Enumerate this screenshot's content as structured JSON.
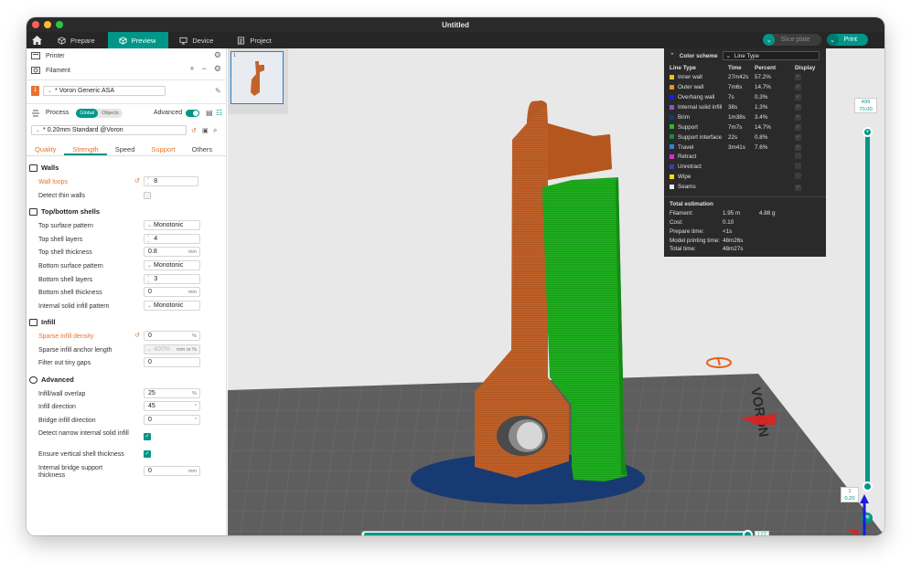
{
  "window": {
    "title": "Untitled"
  },
  "tabs": [
    {
      "label": "Prepare",
      "icon": "cube-outline-icon"
    },
    {
      "label": "Preview",
      "icon": "preview-cube-icon"
    },
    {
      "label": "Device",
      "icon": "device-icon"
    },
    {
      "label": "Project",
      "icon": "project-icon"
    }
  ],
  "toolbar": {
    "slice_label": "Slice plate",
    "print_label": "Print"
  },
  "sidebar": {
    "printer_label": "Printer",
    "filament_label": "Filament",
    "filament_slot": "1",
    "filament_value": "* Voron Generic ASA",
    "process_label": "Process",
    "process_toggle": [
      "Global",
      "Objects"
    ],
    "advanced_label": "Advanced",
    "process_value": "* 0.20mm Standard @Voron",
    "subtabs": [
      "Quality",
      "Strength",
      "Speed",
      "Support",
      "Others"
    ],
    "groups": {
      "walls": "Walls",
      "topbottom": "Top/bottom shells",
      "infill": "Infill",
      "advanced": "Advanced"
    },
    "settings": {
      "wall_loops": {
        "label": "Wall loops",
        "value": "8"
      },
      "detect_thin_walls": {
        "label": "Detect thin walls"
      },
      "top_surface_pattern": {
        "label": "Top surface pattern",
        "value": "Monotonic"
      },
      "top_shell_layers": {
        "label": "Top shell layers",
        "value": "4"
      },
      "top_shell_thickness": {
        "label": "Top shell thickness",
        "value": "0.8",
        "unit": "mm"
      },
      "bottom_surface_pattern": {
        "label": "Bottom surface pattern",
        "value": "Monotonic"
      },
      "bottom_shell_layers": {
        "label": "Bottom shell layers",
        "value": "3"
      },
      "bottom_shell_thickness": {
        "label": "Bottom shell thickness",
        "value": "0",
        "unit": "mm"
      },
      "internal_solid_infill_pattern": {
        "label": "Internal solid infill pattern",
        "value": "Monotonic"
      },
      "sparse_infill_density": {
        "label": "Sparse infill density",
        "value": "0",
        "unit": "%"
      },
      "sparse_infill_anchor_length": {
        "label": "Sparse infill anchor length",
        "value": "400%",
        "unit": "mm or %"
      },
      "filter_out_tiny_gaps": {
        "label": "Filter out tiny gaps",
        "value": "0"
      },
      "infill_wall_overlap": {
        "label": "Infill/wall overlap",
        "value": "25",
        "unit": "%"
      },
      "infill_direction": {
        "label": "Infill direction",
        "value": "45",
        "unit": "°"
      },
      "bridge_infill_direction": {
        "label": "Bridge infill direction",
        "value": "0",
        "unit": "°"
      },
      "detect_narrow_internal_solid_infill": {
        "label": "Detect narrow internal solid infill"
      },
      "ensure_vertical_shell_thickness": {
        "label": "Ensure vertical shell thickness"
      },
      "internal_bridge_support_thickness": {
        "label": "Internal bridge support thickness",
        "value": "0",
        "unit": "mm"
      }
    }
  },
  "legend": {
    "title": "Color scheme",
    "scheme": "Line Type",
    "headers": [
      "Line Type",
      "Time",
      "Percent",
      "Display"
    ],
    "rows": [
      {
        "name": "Inner wall",
        "time": "27m42s",
        "percent": "57.2%",
        "color": "#f0c419"
      },
      {
        "name": "Outer wall",
        "time": "7m6s",
        "percent": "14.7%",
        "color": "#ff8c1a"
      },
      {
        "name": "Overhang wall",
        "time": "7s",
        "percent": "0.3%",
        "color": "#1a1aff"
      },
      {
        "name": "Internal solid infill",
        "time": "38s",
        "percent": "1.3%",
        "color": "#9b4dca"
      },
      {
        "name": "Brim",
        "time": "1m38s",
        "percent": "3.4%",
        "color": "#123c78"
      },
      {
        "name": "Support",
        "time": "7m7s",
        "percent": "14.7%",
        "color": "#1fbf1f"
      },
      {
        "name": "Support interface",
        "time": "22s",
        "percent": "0.8%",
        "color": "#1f8a3a"
      },
      {
        "name": "Travel",
        "time": "3m41s",
        "percent": "7.6%",
        "color": "#3a7fd9"
      },
      {
        "name": "Retract",
        "time": "",
        "percent": "",
        "color": "#cc33cc"
      },
      {
        "name": "Unretract",
        "time": "",
        "percent": "",
        "color": "#3344aa"
      },
      {
        "name": "Wipe",
        "time": "",
        "percent": "",
        "color": "#f0e000"
      },
      {
        "name": "Seams",
        "time": "",
        "percent": "",
        "color": "#e8e8e8"
      }
    ],
    "estimation_title": "Total estimation",
    "estimation": [
      {
        "key": "Filament:",
        "value": "1.95 m",
        "extra": "4.88 g"
      },
      {
        "key": "Cost:",
        "value": "0.10",
        "extra": ""
      },
      {
        "key": "Prepare time:",
        "value": "<1s",
        "extra": ""
      },
      {
        "key": "Model printing time:",
        "value": "48m26s",
        "extra": ""
      },
      {
        "key": "Total time:",
        "value": "48m27s",
        "extra": ""
      }
    ]
  },
  "layer_slider": {
    "top_layer": "499",
    "top_height": "70.00",
    "bottom_layer": "1",
    "bottom_height": "0.20"
  },
  "move_slider": {
    "value": "127"
  },
  "bed": {
    "brand_text": "VORON"
  },
  "colors": {
    "accent": "#009688",
    "orange": "#e6732e",
    "part": "#c3622a",
    "support": "#21b021",
    "brim": "#173a73"
  }
}
